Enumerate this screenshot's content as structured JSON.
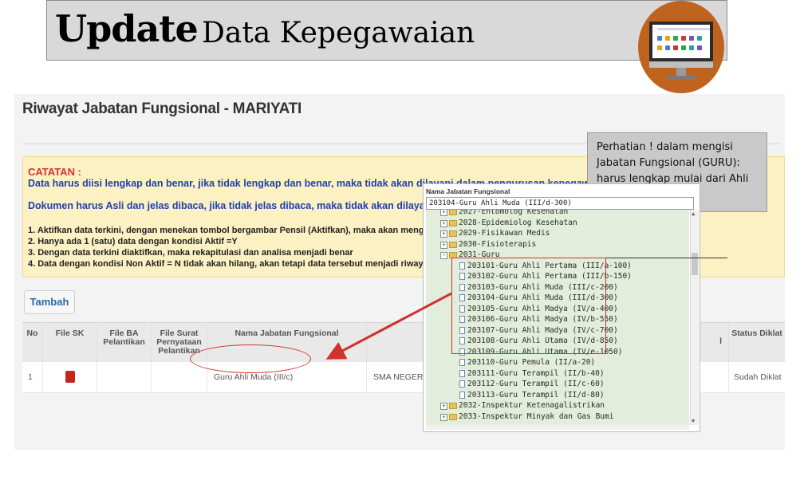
{
  "header": {
    "title_strong": "Update",
    "title_rest": "Data Kepegawaian"
  },
  "panel": {
    "title": "Riwayat Jabatan Fungsional - MARIYATI",
    "catatan_label": "CATATAN :",
    "warning1": "Data harus diisi lengkap dan benar, jika tidak lengkap dan benar, maka tidak akan dilayani dalam pengurusan kepegawaian pada BKD",
    "warning2": "Dokumen harus Asli dan jelas dibaca, jika tidak jelas dibaca, maka tidak akan dilayani dalam pengurusan kepegawaian",
    "rules": [
      "1. Aktifkan data terkini, dengan menekan tombol bergambar Pensil (Aktifkan), maka akan mengubah data dari kondisi Non Aktif menjadi Aktif",
      "2. Hanya ada 1 (satu) data dengan kondisi Aktif =Y",
      "3. Dengan data terkini diaktifkan, maka rekapitulasi dan analisa menjadi benar",
      "4. Data dengan kondisi Non Aktif = N tidak akan hilang, akan tetapi data tersebut menjadi riwayat"
    ],
    "add_button": "Tambah"
  },
  "table": {
    "headers": {
      "no": "No",
      "file_sk": "File SK",
      "file_ba": "File BA Pelantikan",
      "file_surat": "File Surat Pernyataan Pelantikan",
      "nama": "Nama Jabatan Fungsional",
      "diklat_cut": "l",
      "status": "Status Diklat"
    },
    "row": {
      "no": "1",
      "nama": "Guru Ahli Muda (III/c)",
      "unit": "SMA NEGERI",
      "status": "Sudah Diklat"
    }
  },
  "callout": {
    "text": "Perhatian ! dalam mengisi Jabatan Fungsional (GURU): harus lengkap mulai dari Ahli Pertama, dst..."
  },
  "dropdown": {
    "header": "Nama Jabatan Fungsional",
    "selected": "203104-Guru Ahli Muda (III/d-300)",
    "items": [
      {
        "label": "2027-Entomolog Kesehatan",
        "type": "folder"
      },
      {
        "label": "2028-Epidemiolog Kesehatan",
        "type": "folder"
      },
      {
        "label": "2029-Fisikawan Medis",
        "type": "folder"
      },
      {
        "label": "2030-Fisioterapis",
        "type": "folder"
      },
      {
        "label": "2031-Guru",
        "type": "folder-open"
      },
      {
        "label": "203101-Guru Ahli Pertama (III/a-100)",
        "type": "doc"
      },
      {
        "label": "203102-Guru Ahli Pertama (III/b-150)",
        "type": "doc"
      },
      {
        "label": "203103-Guru Ahli Muda (III/c-200)",
        "type": "doc"
      },
      {
        "label": "203104-Guru Ahli Muda (III/d-300)",
        "type": "doc"
      },
      {
        "label": "203105-Guru Ahli Madya (IV/a-400)",
        "type": "doc"
      },
      {
        "label": "203106-Guru Ahli Madya (IV/b-550)",
        "type": "doc"
      },
      {
        "label": "203107-Guru Ahli Madya (IV/c-700)",
        "type": "doc"
      },
      {
        "label": "203108-Guru Ahli Utama (IV/d-850)",
        "type": "doc"
      },
      {
        "label": "203109-Guru Ahli Utama (IV/e-1050)",
        "type": "doc"
      },
      {
        "label": "203110-Guru Pemula (II/a-20)",
        "type": "doc"
      },
      {
        "label": "203111-Guru Terampil (II/b-40)",
        "type": "doc"
      },
      {
        "label": "203112-Guru Terampil (II/c-60)",
        "type": "doc"
      },
      {
        "label": "203113-Guru Terampil (II/d-80)",
        "type": "doc"
      },
      {
        "label": "2032-Inspektur Ketenagalistrikan",
        "type": "folder"
      },
      {
        "label": "2033-Inspektur Minyak dan Gas Bumi",
        "type": "folder"
      }
    ]
  },
  "colors": {
    "highlight": "#d0322e",
    "note_bg": "#fcf1c2",
    "link_blue": "#1f3fb0",
    "tree_bg": "#e2eddb"
  }
}
